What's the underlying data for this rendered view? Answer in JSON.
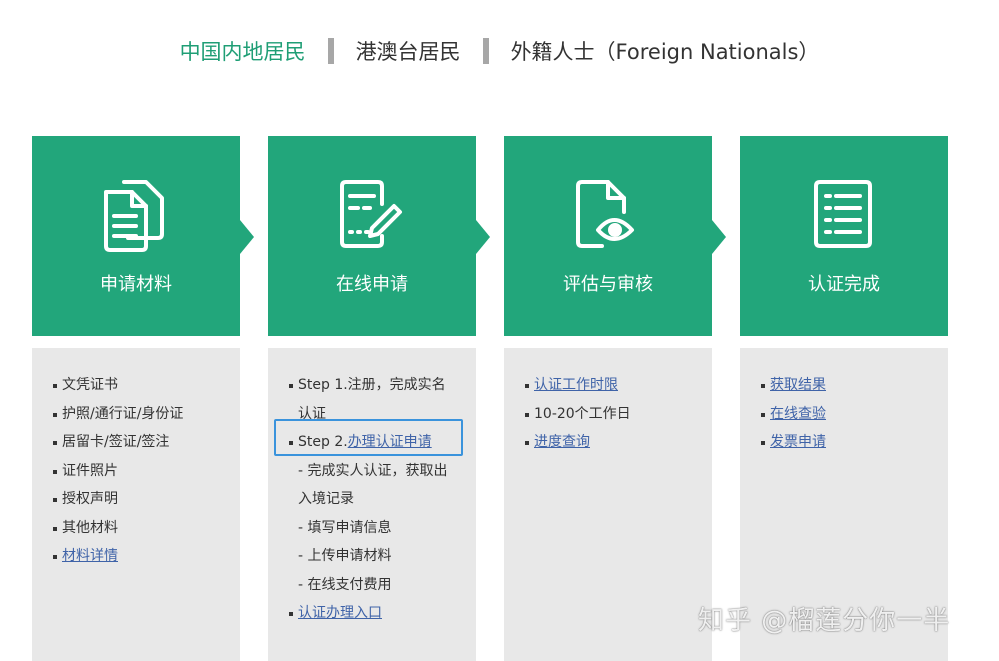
{
  "tabs": [
    "中国内地居民",
    "港澳台居民",
    "外籍人士（Foreign Nationals）"
  ],
  "cards": [
    {
      "title": "申请材料",
      "icon": "documents-icon",
      "items": [
        {
          "text": "文凭证书"
        },
        {
          "text": "护照/通行证/身份证"
        },
        {
          "text": "居留卡/签证/签注"
        },
        {
          "text": "证件照片"
        },
        {
          "text": "授权声明"
        },
        {
          "text": "其他材料"
        },
        {
          "link": "材料详情"
        }
      ]
    },
    {
      "title": "在线申请",
      "icon": "form-edit-icon",
      "items": [
        {
          "text": "Step 1.注册，完成实名"
        },
        {
          "text": "认证"
        },
        {
          "text": "Step 2.",
          "link": "办理认证申请"
        },
        {
          "text": "- 完成实人认证，获取出"
        },
        {
          "text": "入境记录"
        },
        {
          "text": "- 填写申请信息"
        },
        {
          "text": "- 上传申请材料"
        },
        {
          "text": "- 在线支付费用"
        },
        {
          "link": "认证办理入口"
        }
      ]
    },
    {
      "title": "评估与审核",
      "icon": "document-eye-icon",
      "items": [
        {
          "link": "认证工作时限"
        },
        {
          "text": "10-20个工作日"
        },
        {
          "link": "进度查询"
        }
      ]
    },
    {
      "title": "认证完成",
      "icon": "checklist-icon",
      "items": [
        {
          "link": "获取结果"
        },
        {
          "link": "在线查验"
        },
        {
          "link": "发票申请"
        }
      ]
    }
  ],
  "watermark": "知乎 @榴莲分你一半",
  "colors": {
    "accent": "#22a67b",
    "active_tab": "#1f9e75",
    "link": "#3f63a8",
    "panel": "#e8e8e8",
    "highlight": "#3a93dc"
  }
}
